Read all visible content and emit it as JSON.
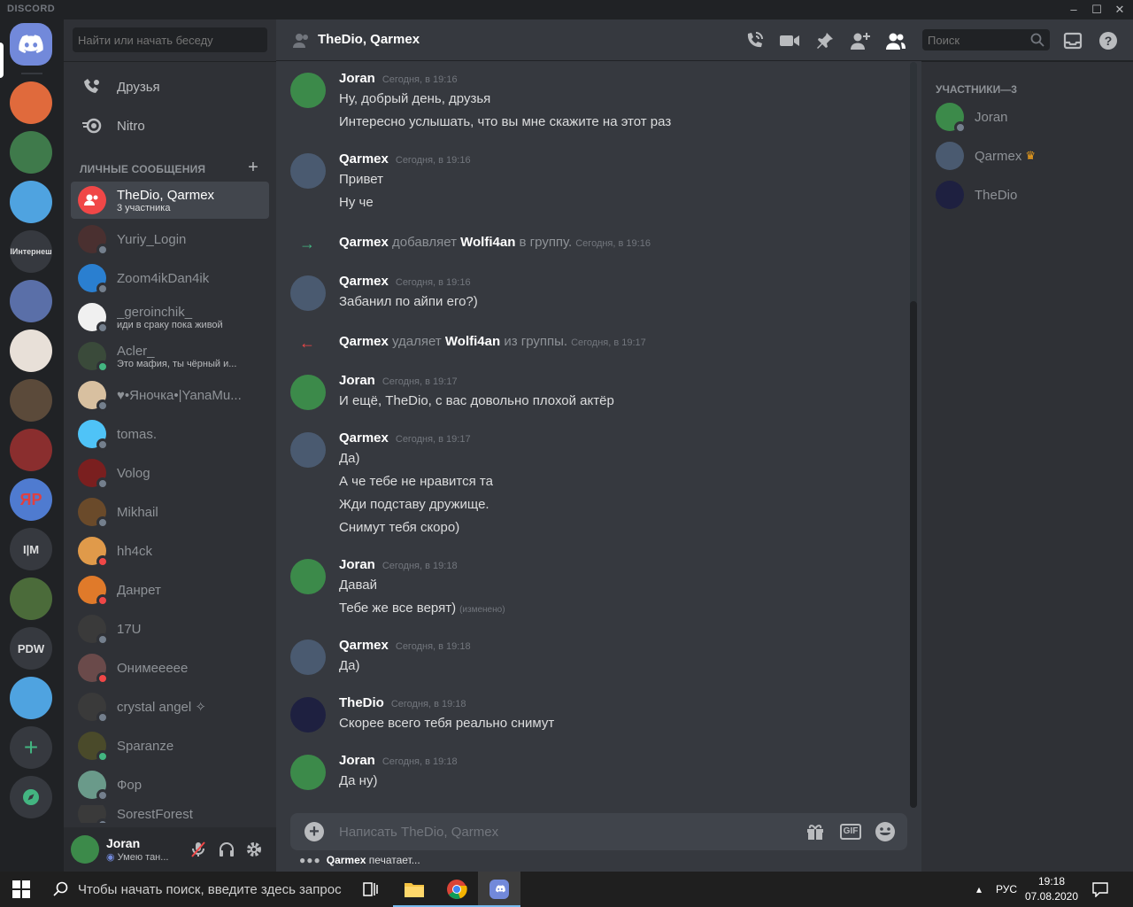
{
  "app": {
    "brand": "DISCORD"
  },
  "colors": {
    "accent": "#7289da",
    "online": "#43b581",
    "offline": "#747f8d",
    "dnd": "#f04747",
    "idle": "#faa61a",
    "bg_main": "#36393f",
    "bg_side": "#2f3136",
    "bg_dark": "#202225"
  },
  "guilds": [
    {
      "label": "",
      "icon": "discord-logo-icon"
    },
    {
      "label": "",
      "color": "#e06a3c"
    },
    {
      "label": "",
      "color": "#3f7a4b"
    },
    {
      "label": "",
      "color": "#4fa3e0"
    },
    {
      "label": "IИнтернеш",
      "color": "#36393f"
    },
    {
      "label": "",
      "color": "#5a6fa8"
    },
    {
      "label": "",
      "color": "#e8e0d8"
    },
    {
      "label": "",
      "color": "#5b4a3a"
    },
    {
      "label": "",
      "color": "#8a2e2e"
    },
    {
      "label": "ЯР",
      "color": "#4f7bd0"
    },
    {
      "label": "I|M",
      "color": "#36393f"
    },
    {
      "label": "",
      "color": "#4b6b3a"
    },
    {
      "label": "PDW",
      "color": "#36393f"
    },
    {
      "label": "",
      "color": "#4fa3e0"
    },
    {
      "label": "+",
      "icon": "add-server-icon"
    },
    {
      "label": "",
      "icon": "explore-compass-icon"
    }
  ],
  "sidebar": {
    "search_placeholder": "Найти или начать беседу",
    "friends": "Друзья",
    "nitro": "Nitro",
    "dm_header": "ЛИЧНЫЕ СООБЩЕНИЯ",
    "dms": [
      {
        "name": "TheDio, Qarmex",
        "sub": "3 участника",
        "color": "#f04747",
        "status": "",
        "active": true
      },
      {
        "name": "Yuriy_Login",
        "sub": "",
        "color": "#4a3030",
        "status": "offline"
      },
      {
        "name": "Zoom4ikDan4ik",
        "sub": "",
        "color": "#2a7fd0",
        "status": "offline"
      },
      {
        "name": "_geroinchik_",
        "sub": "иди в сраку пока живой",
        "color": "#f0f0f0",
        "status": "offline"
      },
      {
        "name": "Acler_",
        "sub": "Это мафия, ты чёрный и...",
        "color": "#3a4a3a",
        "status": "online"
      },
      {
        "name": "♥•Яночка•|YanaMu...",
        "sub": "",
        "color": "#d8c0a0",
        "status": "offline"
      },
      {
        "name": "tomas.",
        "sub": "",
        "color": "#4fc3f7",
        "status": "offline"
      },
      {
        "name": "Volog",
        "sub": "",
        "color": "#7a1f1f",
        "status": "offline"
      },
      {
        "name": "Mikhail",
        "sub": "",
        "color": "#6a4a2a",
        "status": "offline"
      },
      {
        "name": "hh4ck",
        "sub": "",
        "color": "#e09a4a",
        "status": "dnd"
      },
      {
        "name": "Данрет",
        "sub": "",
        "color": "#e07a2a",
        "status": "dnd"
      },
      {
        "name": "17U",
        "sub": "",
        "color": "#3a3a3a",
        "status": "offline"
      },
      {
        "name": "Онимееееe",
        "sub": "",
        "color": "#6a4a4a",
        "status": "dnd"
      },
      {
        "name": "crystal angel ✧",
        "sub": "",
        "color": "#3a3a3a",
        "status": "offline"
      },
      {
        "name": "Sparanze",
        "sub": "",
        "color": "#4a4a2a",
        "status": "online"
      },
      {
        "name": "Фор",
        "sub": "",
        "color": "#6a9a8a",
        "status": "offline"
      },
      {
        "name": "SorestForest",
        "sub": "",
        "color": "#3a3a3a",
        "status": "offline"
      }
    ]
  },
  "user": {
    "name": "Joran",
    "status": "Умею тан..."
  },
  "chat": {
    "title": "TheDio, Qarmex",
    "search_placeholder": "Поиск",
    "composer_placeholder": "Написать TheDio, Qarmex",
    "typing_user": "Qarmex",
    "typing_text": "печатает...",
    "messages": [
      {
        "author": "Joran",
        "ts": "Сегодня, в 19:16",
        "lines": [
          "Ну, добрый день, друзья",
          "Интересно услышать, что вы мне скажите на этот раз"
        ],
        "color": "#3c8a4a"
      },
      {
        "author": "Qarmex",
        "ts": "Сегодня, в 19:16",
        "lines": [
          "Привет",
          "Ну че"
        ],
        "color": "#4a5a70"
      },
      {
        "author": "Qarmex",
        "ts": "Сегодня, в 19:16",
        "lines": [
          "Забанил по айпи его?)"
        ],
        "color": "#4a5a70"
      },
      {
        "author": "Joran",
        "ts": "Сегодня, в 19:17",
        "lines": [
          "И ещё, TheDio, с вас довольно плохой актёр"
        ],
        "color": "#3c8a4a"
      },
      {
        "author": "Qarmex",
        "ts": "Сегодня, в 19:17",
        "lines": [
          "Да)",
          "А че тебе не нравится та",
          "Жди подставу дружище.",
          "Снимут тебя скоро)"
        ],
        "color": "#4a5a70"
      },
      {
        "author": "Joran",
        "ts": "Сегодня, в 19:18",
        "lines": [
          "Давай",
          "Тебе же все верят)"
        ],
        "edited": "(изменено)",
        "color": "#3c8a4a"
      },
      {
        "author": "Qarmex",
        "ts": "Сегодня, в 19:18",
        "lines": [
          "Да)"
        ],
        "color": "#4a5a70"
      },
      {
        "author": "TheDio",
        "ts": "Сегодня, в 19:18",
        "lines": [
          "Скорее всего тебя реально снимут"
        ],
        "color": "#1e2040"
      },
      {
        "author": "Joran",
        "ts": "Сегодня, в 19:18",
        "lines": [
          "Да ну)"
        ],
        "color": "#3c8a4a"
      }
    ],
    "system": [
      {
        "actor": "Qarmex",
        "verb": "добавляет",
        "target": "Wolfi4an",
        "tail": "в группу.",
        "ts": "Сегодня, в 19:16"
      },
      {
        "actor": "Qarmex",
        "verb": "удаляет",
        "target": "Wolfi4an",
        "tail": "из группы.",
        "ts": "Сегодня, в 19:17"
      }
    ]
  },
  "members": {
    "header": "УЧАСТНИКИ—3",
    "list": [
      {
        "name": "Joran",
        "color": "#3c8a4a"
      },
      {
        "name": "Qarmex",
        "color": "#4a5a70",
        "owner": true
      },
      {
        "name": "TheDio",
        "color": "#1e2040"
      }
    ]
  },
  "taskbar": {
    "search_text": "Чтобы начать поиск, введите здесь запрос",
    "lang": "РУС",
    "time": "19:18",
    "date": "07.08.2020"
  }
}
